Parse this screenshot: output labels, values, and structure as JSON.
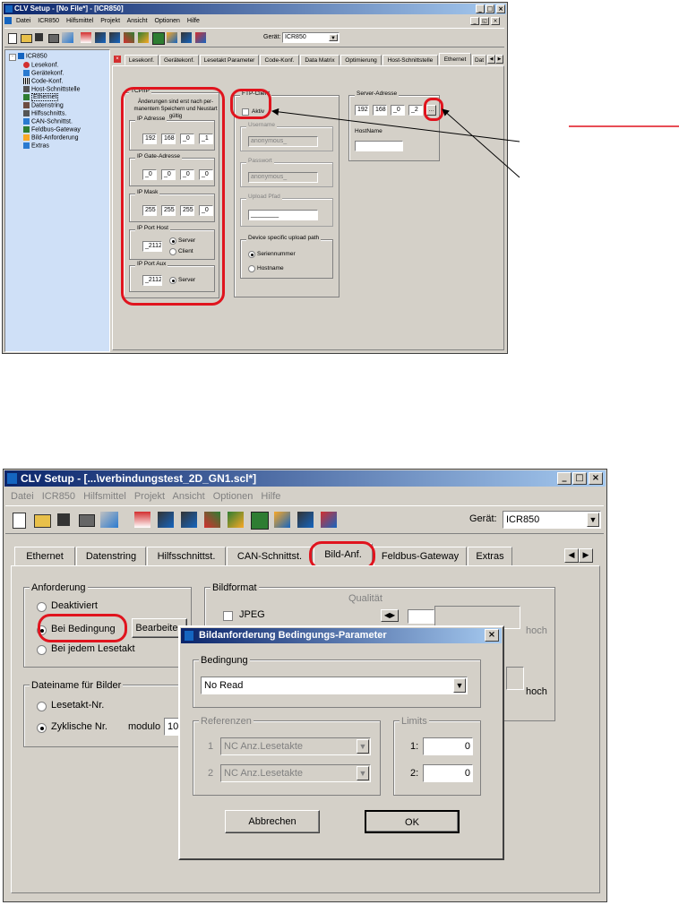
{
  "top": {
    "title": "CLV Setup - [No File*] - [ICR850]",
    "menu": [
      "Datei",
      "ICR850",
      "Hilfsmittel",
      "Projekt",
      "Ansicht",
      "Optionen",
      "Hilfe"
    ],
    "device_label": "Gerät:",
    "device_value": "ICR850",
    "tree": {
      "root": "ICR850",
      "items": [
        "Lesekonf.",
        "Gerätekonf.",
        "Code-Konf.",
        "Host-Schnittstelle",
        "Ethernet",
        "Datenstring",
        "Hilfsschnitts.",
        "CAN-Schnittst.",
        "Feldbus-Gateway",
        "Bild-Anforderung",
        "Extras"
      ]
    },
    "tabs": [
      "Lesekonf.",
      "Gerätekonf.",
      "Lesetakt Parameter",
      "Code-Konf.",
      "Data Matrix",
      "Optimierung",
      "Host-Schnittstelle",
      "Ethernet",
      "Dat"
    ],
    "tcpip": {
      "title": "TCP/IP",
      "note": "Änderungen sind erst nach per- manentem Speichern und Neustart gültig",
      "ip_address_title": "IP Adresse",
      "ip_address": [
        "192",
        "168",
        "_0",
        "_1"
      ],
      "gateway_title": "IP Gate-Adresse",
      "gateway": [
        "_0",
        "_0",
        "_0",
        "_0"
      ],
      "mask_title": "IP Mask",
      "mask": [
        "255",
        "255",
        "255",
        "_0"
      ],
      "port_host_title": "IP Port Host",
      "port_host": "_2112",
      "server_label": "Server",
      "client_label": "Client",
      "port_aux_title": "IP Port Aux",
      "port_aux": "_2112",
      "server_aux_label": "Server"
    },
    "ftp": {
      "title": "FTP-Client",
      "active_label": "Aktiv",
      "username_title": "Username",
      "username": "anonymous_",
      "password_title": "Passwort",
      "password": "anonymous_",
      "upload_title": "Upload Pfad",
      "upload": "________",
      "device_path_title": "Device specific upload path",
      "serial_label": "Seriennummer",
      "hostname_label": "Hostname"
    },
    "server": {
      "title": "Server-Adresse",
      "address": [
        "192",
        "168",
        "_0",
        "_2"
      ],
      "browse": "...",
      "hostname_title": "HostName"
    }
  },
  "bottom": {
    "title": "CLV Setup - [...\\verbindungstest_2D_GN1.scl*]",
    "menu": [
      "Datei",
      "ICR850",
      "Hilfsmittel",
      "Projekt",
      "Ansicht",
      "Optionen",
      "Hilfe"
    ],
    "device_label": "Gerät:",
    "device_value": "ICR850",
    "tabs": [
      "Ethernet",
      "Datenstring",
      "Hilfsschnittst.",
      "CAN-Schnittst.",
      "Bild-Anf.",
      "Feldbus-Gateway",
      "Extras"
    ],
    "anforderung": {
      "title": "Anforderung",
      "deaktiviert": "Deaktiviert",
      "bei_bedingung": "Bei Bedingung",
      "bearbeiten": "Bearbeiten",
      "bei_jedem": "Bei jedem Lesetakt"
    },
    "dateiname": {
      "title": "Dateiname für Bilder",
      "lesetakt": "Lesetakt-Nr.",
      "zyklisch": "Zyklische Nr.",
      "modulo_label": "modulo",
      "modulo_value": "10"
    },
    "bildformat": {
      "title": "Bildformat",
      "jpeg": "JPEG",
      "qualitaet": "Qualität",
      "hoch1": "hoch",
      "hoch2": "hoch"
    },
    "dialog": {
      "title": "Bildanforderung Bedingungs-Parameter",
      "bedingung_title": "Bedingung",
      "bedingung_value": "No Read",
      "referenzen_title": "Referenzen",
      "ref1_num": "1",
      "ref1": "NC Anz.Lesetakte",
      "ref2_num": "2",
      "ref2": "NC Anz.Lesetakte",
      "limits_title": "Limits",
      "limit1_label": "1:",
      "limit1": "0",
      "limit2_label": "2:",
      "limit2": "0",
      "cancel": "Abbrechen",
      "ok": "OK"
    }
  },
  "colors": {
    "annotation_red": "#e0141e",
    "title_blue": "#0a246a",
    "window_gray": "#d4d0c8"
  }
}
